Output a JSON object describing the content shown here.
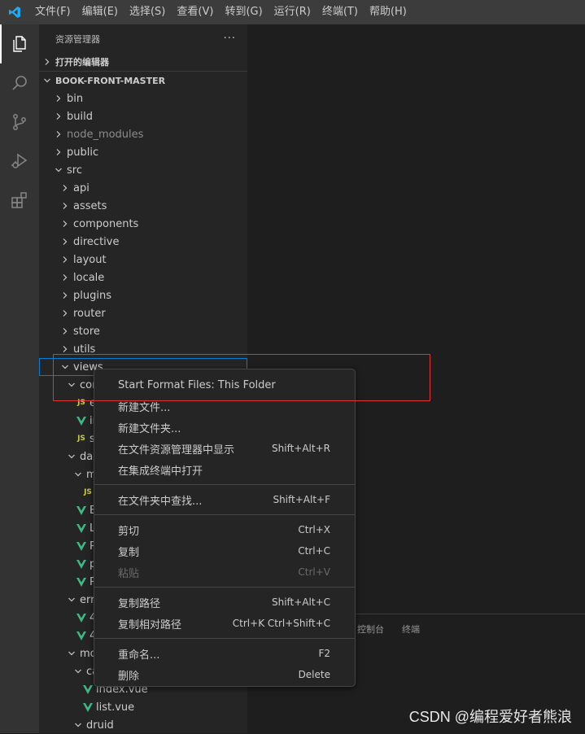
{
  "menubar": {
    "items": [
      "文件(F)",
      "编辑(E)",
      "选择(S)",
      "查看(V)",
      "转到(G)",
      "运行(R)",
      "终端(T)",
      "帮助(H)"
    ]
  },
  "activitybar": {
    "icons": [
      "files-icon",
      "search-icon",
      "source-control-icon",
      "run-debug-icon",
      "extensions-icon"
    ]
  },
  "sidebar": {
    "title": "资源管理器",
    "more": "···",
    "open_editors": "打开的编辑器",
    "project": "BOOK-FRONT-MASTER",
    "tree": [
      {
        "label": "bin",
        "depth": 0,
        "kind": "folder",
        "open": false
      },
      {
        "label": "build",
        "depth": 0,
        "kind": "folder",
        "open": false
      },
      {
        "label": "node_modules",
        "depth": 0,
        "kind": "folder",
        "open": false,
        "dim": true
      },
      {
        "label": "public",
        "depth": 0,
        "kind": "folder",
        "open": false
      },
      {
        "label": "src",
        "depth": 0,
        "kind": "folder",
        "open": true
      },
      {
        "label": "api",
        "depth": 1,
        "kind": "folder",
        "open": false
      },
      {
        "label": "assets",
        "depth": 1,
        "kind": "folder",
        "open": false
      },
      {
        "label": "components",
        "depth": 1,
        "kind": "folder",
        "open": false
      },
      {
        "label": "directive",
        "depth": 1,
        "kind": "folder",
        "open": false
      },
      {
        "label": "layout",
        "depth": 1,
        "kind": "folder",
        "open": false
      },
      {
        "label": "locale",
        "depth": 1,
        "kind": "folder",
        "open": false
      },
      {
        "label": "plugins",
        "depth": 1,
        "kind": "folder",
        "open": false
      },
      {
        "label": "router",
        "depth": 1,
        "kind": "folder",
        "open": false
      },
      {
        "label": "store",
        "depth": 1,
        "kind": "folder",
        "open": false
      },
      {
        "label": "utils",
        "depth": 1,
        "kind": "folder",
        "open": false
      },
      {
        "label": "views",
        "depth": 1,
        "kind": "folder",
        "open": true,
        "selected": true
      },
      {
        "label": "cor",
        "depth": 2,
        "kind": "folder",
        "open": true
      },
      {
        "label": "e",
        "depth": 3,
        "kind": "js"
      },
      {
        "label": "ir",
        "depth": 3,
        "kind": "vue"
      },
      {
        "label": "sv",
        "depth": 3,
        "kind": "js"
      },
      {
        "label": "das",
        "depth": 2,
        "kind": "folder",
        "open": true
      },
      {
        "label": "m",
        "depth": 3,
        "kind": "folder",
        "open": true
      },
      {
        "label": "",
        "depth": 4,
        "kind": "js"
      },
      {
        "label": "B",
        "depth": 3,
        "kind": "vue"
      },
      {
        "label": "Li",
        "depth": 3,
        "kind": "vue"
      },
      {
        "label": "P",
        "depth": 3,
        "kind": "vue"
      },
      {
        "label": "p",
        "depth": 3,
        "kind": "vue"
      },
      {
        "label": "R",
        "depth": 3,
        "kind": "vue"
      },
      {
        "label": "err",
        "depth": 2,
        "kind": "folder",
        "open": true
      },
      {
        "label": "4",
        "depth": 3,
        "kind": "vue"
      },
      {
        "label": "4",
        "depth": 3,
        "kind": "vue"
      },
      {
        "label": "mo",
        "depth": 2,
        "kind": "folder",
        "open": true
      },
      {
        "label": "ca",
        "depth": 3,
        "kind": "folder",
        "open": true
      },
      {
        "label": "index.vue",
        "depth": 4,
        "kind": "vue"
      },
      {
        "label": "list.vue",
        "depth": 4,
        "kind": "vue"
      },
      {
        "label": "druid",
        "depth": 3,
        "kind": "folder",
        "open": true
      }
    ]
  },
  "panel": {
    "tabs": [
      "控制台",
      "终端"
    ]
  },
  "context_menu": {
    "groups": [
      [
        {
          "label": "Start Format Files: This Folder",
          "shortcut": ""
        },
        {
          "label": "新建文件...",
          "shortcut": ""
        },
        {
          "label": "新建文件夹...",
          "shortcut": ""
        },
        {
          "label": "在文件资源管理器中显示",
          "shortcut": "Shift+Alt+R"
        },
        {
          "label": "在集成终端中打开",
          "shortcut": ""
        }
      ],
      [
        {
          "label": "在文件夹中查找...",
          "shortcut": "Shift+Alt+F"
        }
      ],
      [
        {
          "label": "剪切",
          "shortcut": "Ctrl+X"
        },
        {
          "label": "复制",
          "shortcut": "Ctrl+C"
        },
        {
          "label": "粘贴",
          "shortcut": "Ctrl+V",
          "disabled": true
        }
      ],
      [
        {
          "label": "复制路径",
          "shortcut": "Shift+Alt+C"
        },
        {
          "label": "复制相对路径",
          "shortcut": "Ctrl+K Ctrl+Shift+C"
        }
      ],
      [
        {
          "label": "重命名...",
          "shortcut": "F2"
        },
        {
          "label": "删除",
          "shortcut": "Delete"
        }
      ]
    ]
  },
  "watermark": "CSDN @编程爱好者熊浪",
  "colors": {
    "accent": "#007fd4",
    "highlight_box": "#e03535",
    "vue_green": "#41b883",
    "js_yellow": "#cbcb41"
  }
}
